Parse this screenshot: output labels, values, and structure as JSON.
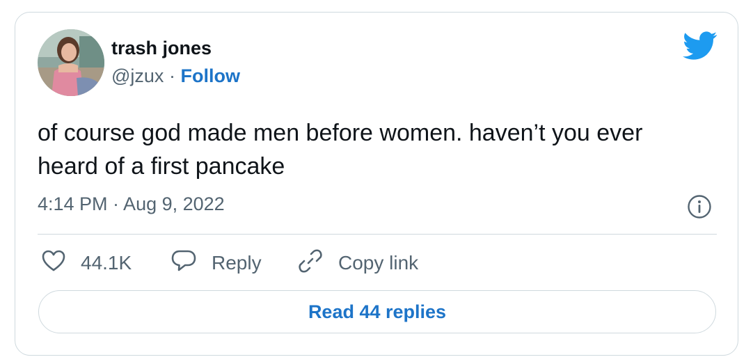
{
  "tweet": {
    "author_name": "trash jones",
    "handle": "@jzux",
    "separator": "·",
    "follow_label": "Follow",
    "text": "of course god made men before women. haven’t you ever heard of a first pancake",
    "timestamp": "4:14 PM · Aug 9, 2022",
    "likes_count": "44.1K",
    "reply_label": "Reply",
    "copy_link_label": "Copy link",
    "read_replies_label": "Read 44 replies"
  },
  "icons": {
    "brand": "twitter-bird-icon",
    "info": "info-icon",
    "like": "heart-icon",
    "reply": "speech-bubble-icon",
    "copy_link": "link-icon"
  },
  "colors": {
    "accent": "#1d9bf0",
    "link": "#1d74c8",
    "text": "#0f1419",
    "muted": "#536471",
    "border": "#cfd9de"
  }
}
